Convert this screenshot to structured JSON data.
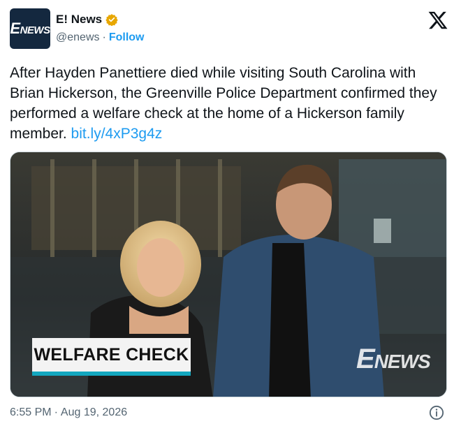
{
  "author": {
    "display_name": "E! News",
    "handle": "@enews",
    "separator": "·",
    "follow_label": "Follow",
    "avatar_text": "NEWS",
    "avatar_e": "E",
    "verified_color": "#e8a700"
  },
  "tweet": {
    "text": "After Hayden Panettiere died while visiting South Carolina with Brian Hickerson, the Greenville Police Department confirmed they performed a welfare check at the home of a Hickerson family member. ",
    "link": "bit.ly/4xP3g4z"
  },
  "media": {
    "overlay_label": "WELFARE CHECK",
    "watermark_e": "E",
    "watermark_text": "NEWS"
  },
  "footer": {
    "time": "6:55 PM",
    "separator": "·",
    "date": "Aug 19, 2026"
  },
  "icons": {
    "x_logo": "x-logo-icon",
    "verified": "verified-badge-icon",
    "info": "info-icon"
  },
  "colors": {
    "link": "#1d9bf0",
    "muted": "#536471",
    "accent_bar": "#13a7bf"
  }
}
